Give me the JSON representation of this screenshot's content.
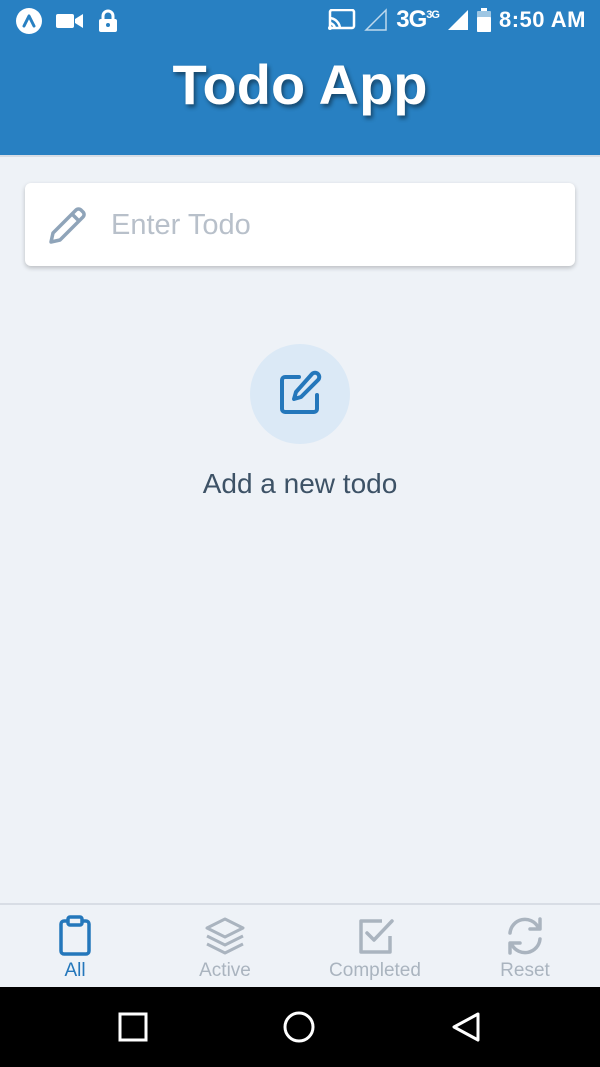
{
  "status_bar": {
    "network": "3G",
    "network_sup": "3G",
    "time": "8:50 AM",
    "icons": [
      "app-logo-icon",
      "video-camera-icon",
      "lock-icon",
      "cast-icon",
      "signal-empty-icon",
      "signal-icon",
      "battery-icon"
    ]
  },
  "header": {
    "title": "Todo App",
    "color": "#2880c2"
  },
  "input": {
    "placeholder": "Enter Todo",
    "value": ""
  },
  "empty_state": {
    "message": "Add a new todo"
  },
  "tabs": [
    {
      "label": "All",
      "icon": "clipboard-icon",
      "active": true
    },
    {
      "label": "Active",
      "icon": "layers-icon",
      "active": false
    },
    {
      "label": "Completed",
      "icon": "checkbox-icon",
      "active": false
    },
    {
      "label": "Reset",
      "icon": "refresh-icon",
      "active": false
    }
  ],
  "colors": {
    "accent": "#2477bb",
    "inactive_tab": "#aab4bf",
    "background": "#eef2f7"
  }
}
